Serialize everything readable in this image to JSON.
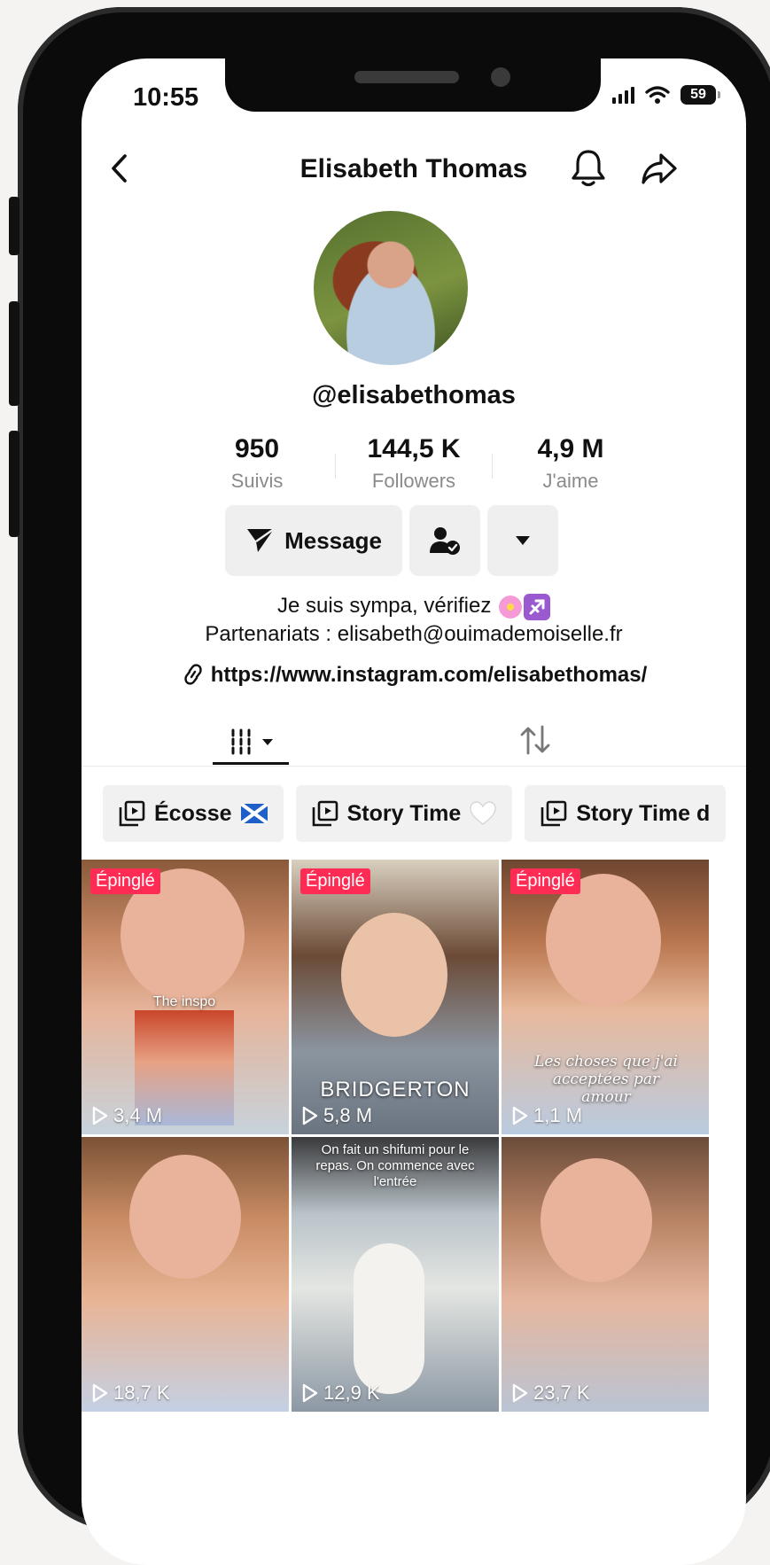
{
  "status": {
    "time": "10:55",
    "battery": "59"
  },
  "header": {
    "title": "Elisabeth Thomas"
  },
  "profile": {
    "handle": "@elisabethomas",
    "stats": [
      {
        "value": "950",
        "label": "Suivis"
      },
      {
        "value": "144,5 K",
        "label": "Followers"
      },
      {
        "value": "4,9 M",
        "label": "J'aime"
      }
    ],
    "message_label": "Message",
    "bio_line1": "Je suis sympa, vérifiez",
    "bio_line2": "Partenariats : elisabeth@ouimademoiselle.fr",
    "link": "https://www.instagram.com/elisabethomas/"
  },
  "playlists": [
    {
      "label": "Écosse"
    },
    {
      "label": "Story Time"
    },
    {
      "label": "Story Time d"
    }
  ],
  "videos": [
    {
      "pinned": "Épinglé",
      "views": "3,4 M",
      "overlay": "The inspo"
    },
    {
      "pinned": "Épinglé",
      "views": "5,8 M",
      "overlay": "BRIDGERTON"
    },
    {
      "pinned": "Épinglé",
      "views": "1,1 M",
      "overlay": "Les choses que j'ai acceptées par amour"
    },
    {
      "views": "18,7 K"
    },
    {
      "views": "12,9 K",
      "overlay": "On fait un shifumi pour le repas. On commence avec l'entrée"
    },
    {
      "views": "23,7 K"
    }
  ],
  "colors": {
    "accent": "#fe2c55",
    "text": "#111111",
    "muted": "#8a8a8a",
    "button_bg": "#efefef"
  }
}
